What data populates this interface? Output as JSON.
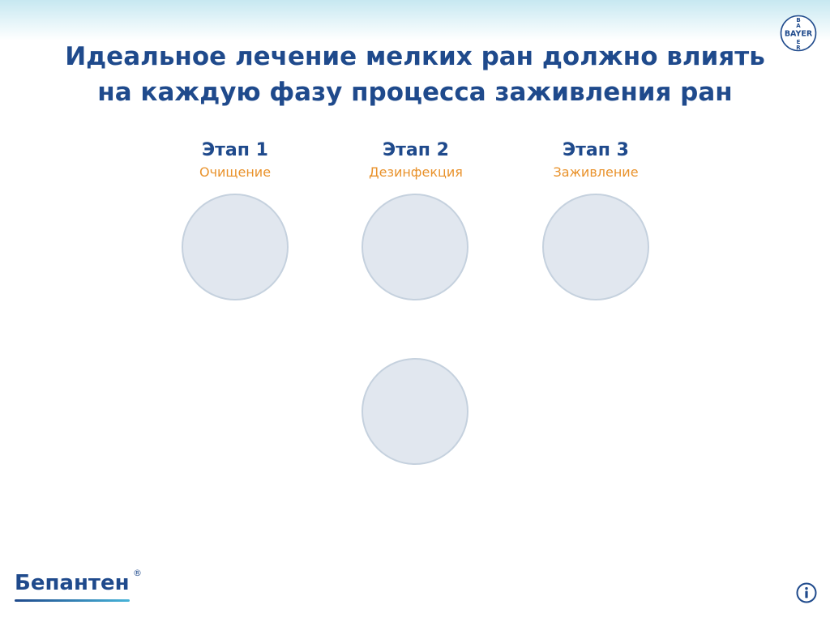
{
  "header": {
    "title_line1": "Идеальное лечение мелких ран должно влиять",
    "title_line2": "на каждую фазу процесса заживления ран",
    "logo": {
      "text": "BAYER",
      "vertical_letters": "B A Y E R",
      "icon": "bayer-cross-logo"
    }
  },
  "stages": [
    {
      "title": "Этап 1",
      "subtitle": "Очищение"
    },
    {
      "title": "Этап 2",
      "subtitle": "Дезинфекция"
    },
    {
      "title": "Этап 3",
      "subtitle": "Заживление"
    }
  ],
  "footer": {
    "brand_name": "Бепантен",
    "registered_mark": "®",
    "info_icon": "info-icon"
  },
  "colors": {
    "title_blue": "#1f4a8c",
    "subtitle_orange": "#e9922b",
    "circle_fill": "#e1e7ef",
    "circle_border": "#c5d1de",
    "header_gradient_top": "#c7e8f1",
    "brand_bar_start": "#1f4a8c",
    "brand_bar_end": "#46b3d8"
  }
}
